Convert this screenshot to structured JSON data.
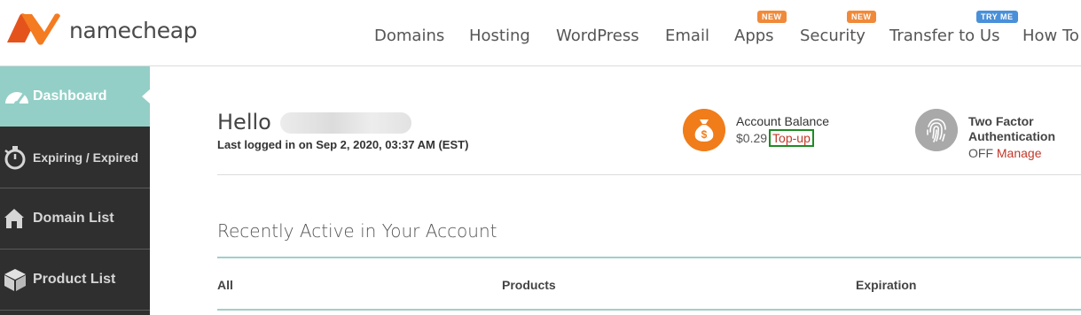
{
  "header": {
    "brand": "namecheap",
    "nav": [
      {
        "label": "Domains",
        "badge": ""
      },
      {
        "label": "Hosting",
        "badge": ""
      },
      {
        "label": "WordPress",
        "badge": ""
      },
      {
        "label": "Email",
        "badge": ""
      },
      {
        "label": "Apps",
        "badge": "NEW"
      },
      {
        "label": "Security",
        "badge": "NEW"
      },
      {
        "label": "Transfer to Us",
        "badge": "TRY ME"
      },
      {
        "label": "How To",
        "badge": ""
      }
    ],
    "colors": {
      "logo": "#f26622",
      "badge_new": "#f08a3a",
      "badge_try": "#4a90d9"
    }
  },
  "sidebar": {
    "items": [
      {
        "label": "Dashboard",
        "icon": "speedometer-icon",
        "active": true
      },
      {
        "label": "Expiring / Expired",
        "icon": "stopwatch-icon",
        "active": false
      },
      {
        "label": "Domain List",
        "icon": "house-icon",
        "active": false
      },
      {
        "label": "Product List",
        "icon": "box-icon",
        "active": false
      }
    ]
  },
  "main": {
    "greeting": "Hello",
    "last_login": "Last logged in on Sep 2, 2020, 03:37 AM (EST)",
    "account_balance": {
      "title": "Account Balance",
      "amount": "$0.29",
      "action": "Top-up",
      "icon": "money-bag-icon"
    },
    "two_factor": {
      "title": "Two Factor Authentication",
      "status": "OFF",
      "action": "Manage",
      "icon": "fingerprint-icon"
    },
    "recent_section": {
      "title": "Recently Active in Your Account",
      "columns": [
        "All",
        "Products",
        "Expiration"
      ]
    }
  }
}
